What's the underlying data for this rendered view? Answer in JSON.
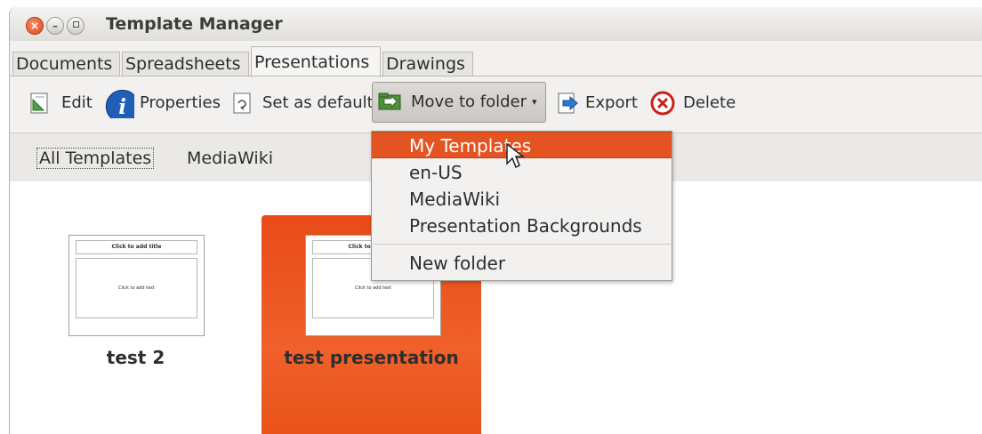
{
  "window": {
    "title": "Template Manager"
  },
  "tabs": [
    "Documents",
    "Spreadsheets",
    "Presentations",
    "Drawings"
  ],
  "toolbar": {
    "edit": "Edit",
    "properties": "Properties",
    "set_default": "Set as default",
    "move_to_folder": "Move to folder",
    "export": "Export",
    "delete": "Delete"
  },
  "folders": [
    "All Templates",
    "MediaWiki"
  ],
  "menu": {
    "items": [
      "My Templates",
      "en-US",
      "MediaWiki",
      "Presentation Backgrounds"
    ],
    "new_folder": "New folder"
  },
  "templates": [
    {
      "name": "test 2",
      "slide_title": "Click to add title",
      "slide_text": "Click to add text"
    },
    {
      "name": "test presentation",
      "slide_title": "Click to add title",
      "slide_text": "Click to add text"
    }
  ],
  "colors": {
    "accent": "#e35422",
    "selected_tile": "#ea5419"
  }
}
